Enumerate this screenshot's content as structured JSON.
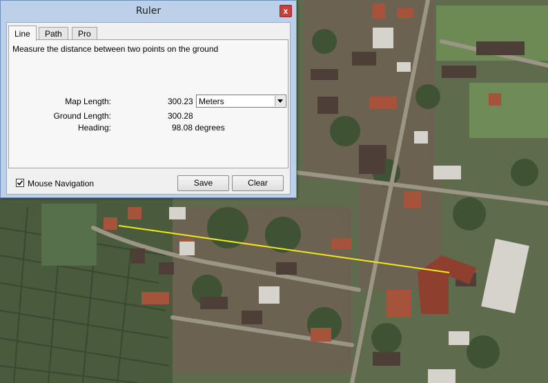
{
  "window": {
    "title": "Ruler",
    "close_glyph": "x"
  },
  "tabs": [
    {
      "label": "Line",
      "active": true
    },
    {
      "label": "Path",
      "active": false
    },
    {
      "label": "Pro",
      "active": false
    }
  ],
  "panel": {
    "description": "Measure the distance between two points on the ground",
    "map_length_label": "Map Length:",
    "map_length_value": "300.23",
    "unit_selected": "Meters",
    "ground_length_label": "Ground Length:",
    "ground_length_value": "300.28",
    "heading_label": "Heading:",
    "heading_value": "98.08 degrees"
  },
  "footer": {
    "mouse_navigation_label": "Mouse Navigation",
    "mouse_navigation_checked": true,
    "save_label": "Save",
    "clear_label": "Clear"
  },
  "map": {
    "measure_line_color": "#f2ea16"
  },
  "icons": [
    "close-icon",
    "dropdown-arrow-icon",
    "checkmark-icon"
  ],
  "colors": {
    "title_bar": "#bcd0ea",
    "close_button": "#c9403a"
  }
}
